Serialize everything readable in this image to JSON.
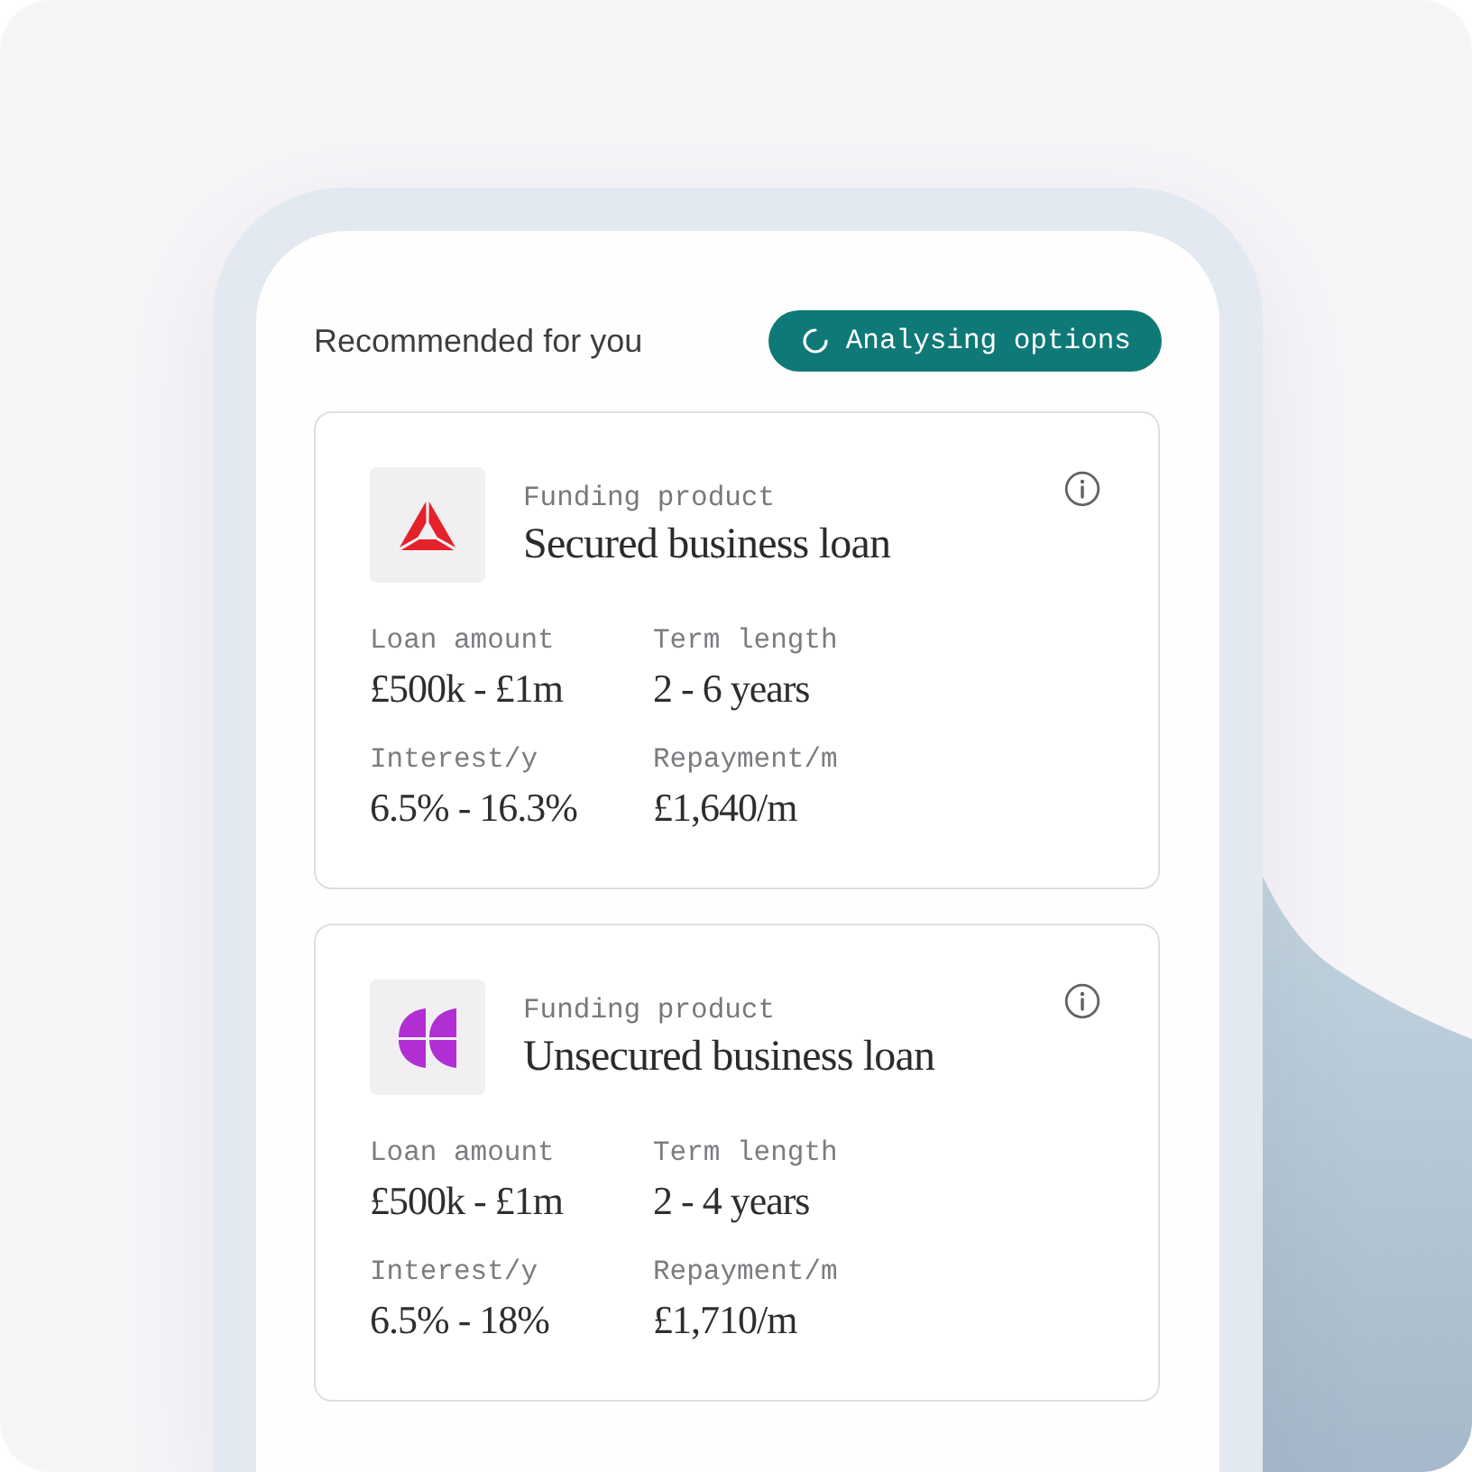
{
  "header": {
    "title": "Recommended for you",
    "status": {
      "label": "Analysing options"
    }
  },
  "products": [
    {
      "kind": "secured",
      "eyebrow": "Funding product",
      "title": "Secured business loan",
      "stats": [
        {
          "label": "Loan amount",
          "value": "£500k - £1m"
        },
        {
          "label": "Term length",
          "value": "2 - 6 years"
        },
        {
          "label": "Interest/y",
          "value": "6.5% - 16.3%"
        },
        {
          "label": "Repayment/m",
          "value": "£1,640/m"
        }
      ]
    },
    {
      "kind": "unsecured",
      "eyebrow": "Funding product",
      "title": "Unsecured business loan",
      "stats": [
        {
          "label": "Loan amount",
          "value": "£500k - £1m"
        },
        {
          "label": "Term length",
          "value": "2 - 4 years"
        },
        {
          "label": "Interest/y",
          "value": "6.5% - 18%"
        },
        {
          "label": "Repayment/m",
          "value": "£1,710/m"
        }
      ]
    }
  ]
}
